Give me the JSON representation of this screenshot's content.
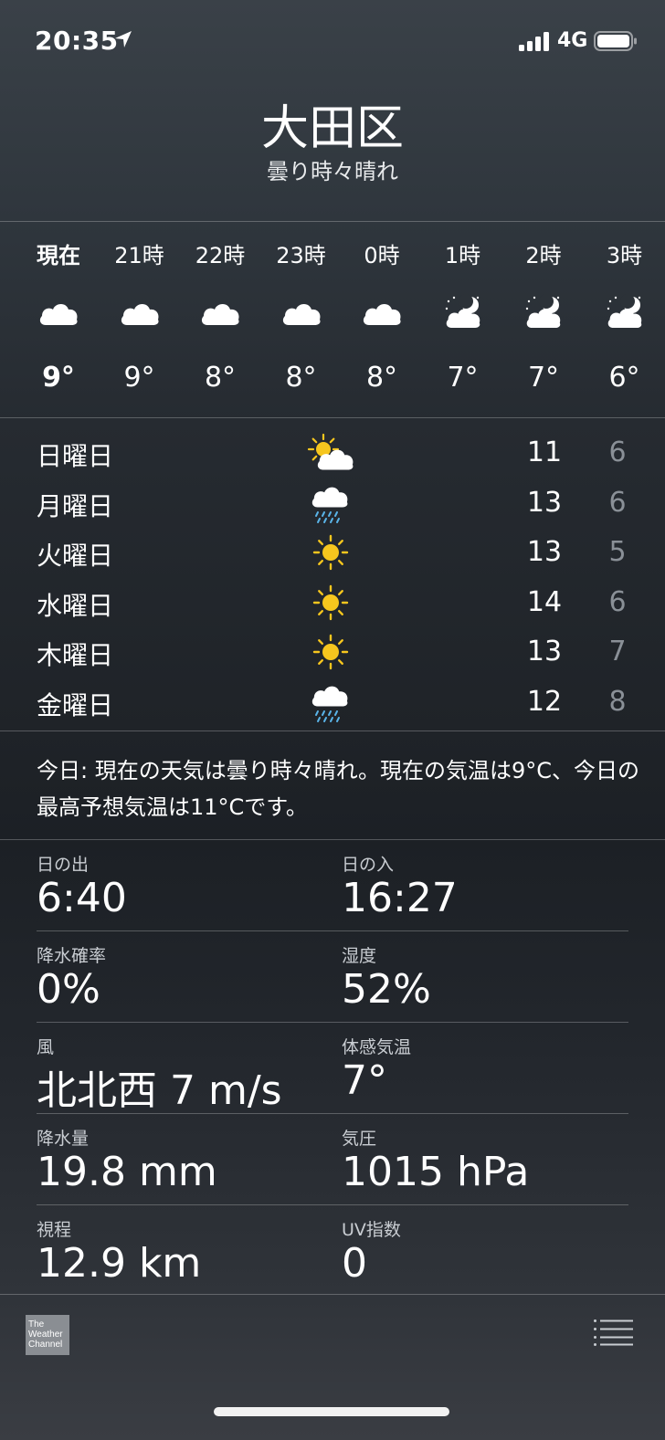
{
  "status_bar": {
    "time": "20:35",
    "network": "4G"
  },
  "header": {
    "city": "大田区",
    "condition": "曇り時々晴れ"
  },
  "hourly": [
    {
      "label": "現在",
      "icon": "cloud-icon",
      "temp": "9°"
    },
    {
      "label": "21時",
      "icon": "cloud-icon",
      "temp": "9°"
    },
    {
      "label": "22時",
      "icon": "cloud-icon",
      "temp": "8°"
    },
    {
      "label": "23時",
      "icon": "cloud-icon",
      "temp": "8°"
    },
    {
      "label": "0時",
      "icon": "cloud-icon",
      "temp": "8°"
    },
    {
      "label": "1時",
      "icon": "cloud-moon-icon",
      "temp": "7°"
    },
    {
      "label": "2時",
      "icon": "cloud-moon-icon",
      "temp": "7°"
    },
    {
      "label": "3時",
      "icon": "cloud-moon-icon",
      "temp": "6°"
    }
  ],
  "daily": [
    {
      "day": "日曜日",
      "icon": "partly-cloudy-icon",
      "high": "11",
      "low": "6"
    },
    {
      "day": "月曜日",
      "icon": "rain-icon",
      "high": "13",
      "low": "6"
    },
    {
      "day": "火曜日",
      "icon": "sun-icon",
      "high": "13",
      "low": "5"
    },
    {
      "day": "水曜日",
      "icon": "sun-icon",
      "high": "14",
      "low": "6"
    },
    {
      "day": "木曜日",
      "icon": "sun-icon",
      "high": "13",
      "low": "7"
    },
    {
      "day": "金曜日",
      "icon": "rain-icon",
      "high": "12",
      "low": "8"
    }
  ],
  "summary": "今日: 現在の天気は曇り時々晴れ。現在の気温は9°C、今日の最高予想気温は11°Cです。",
  "details": [
    {
      "left": {
        "label": "日の出",
        "value": "6:40"
      },
      "right": {
        "label": "日の入",
        "value": "16:27"
      }
    },
    {
      "left": {
        "label": "降水確率",
        "value": "0%"
      },
      "right": {
        "label": "湿度",
        "value": "52%"
      }
    },
    {
      "left": {
        "label": "風",
        "value": "北北西 7 m/s"
      },
      "right": {
        "label": "体感気温",
        "value": "7°"
      }
    },
    {
      "left": {
        "label": "降水量",
        "value": "19.8 mm"
      },
      "right": {
        "label": "気圧",
        "value": "1015 hPa"
      }
    },
    {
      "left": {
        "label": "視程",
        "value": "12.9 km"
      },
      "right": {
        "label": "UV指数",
        "value": "0"
      }
    }
  ],
  "footer": {
    "logo_lines": [
      "The",
      "Weather",
      "Channel"
    ]
  },
  "colors": {
    "sun": "#f6c61e",
    "rain": "#5ab4e8",
    "low_temp": "#8a9097"
  }
}
